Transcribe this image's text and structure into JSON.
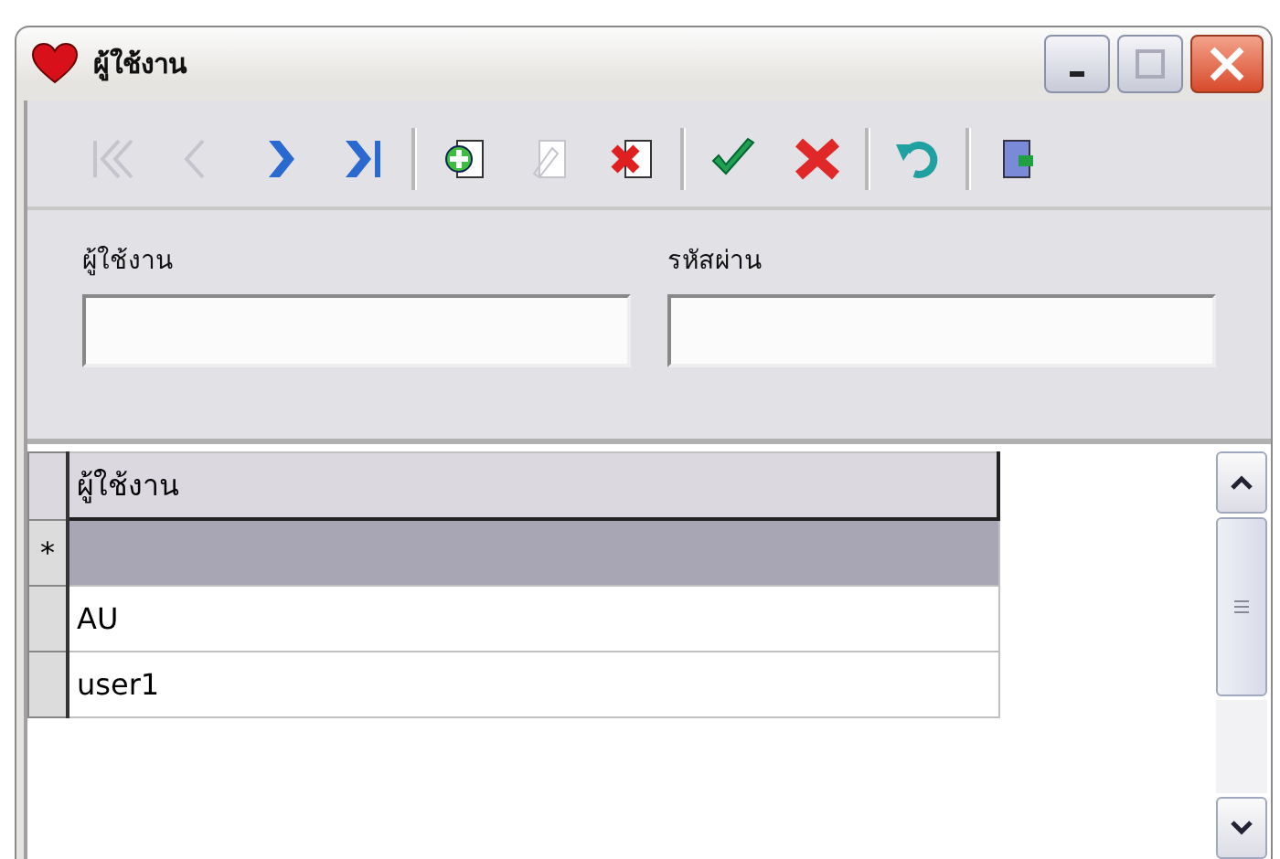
{
  "window": {
    "title": "ผู้ใช้งาน"
  },
  "toolbar": [
    {
      "kind": "first",
      "disabled": true
    },
    {
      "kind": "prev",
      "disabled": true
    },
    {
      "kind": "next",
      "disabled": false
    },
    {
      "kind": "last",
      "disabled": false
    },
    {
      "kind": "sep"
    },
    {
      "kind": "add",
      "disabled": false
    },
    {
      "kind": "edit",
      "disabled": true
    },
    {
      "kind": "delete",
      "disabled": false
    },
    {
      "kind": "sep"
    },
    {
      "kind": "save",
      "disabled": false
    },
    {
      "kind": "cancel",
      "disabled": false
    },
    {
      "kind": "sep"
    },
    {
      "kind": "undo",
      "disabled": false
    },
    {
      "kind": "sep"
    },
    {
      "kind": "exit",
      "disabled": false
    }
  ],
  "form": {
    "fields": [
      {
        "label": "ผู้ใช้งาน"
      },
      {
        "label": "รหัสผ่าน"
      }
    ]
  },
  "grid": {
    "columns": [
      "ผู้ใช้งาน"
    ],
    "rows": [
      {
        "indicator": "*",
        "selected": true,
        "cells": []
      },
      {
        "selected": false,
        "cells": [
          "AU"
        ]
      },
      {
        "selected": false,
        "cells": [
          "user1"
        ]
      }
    ]
  }
}
